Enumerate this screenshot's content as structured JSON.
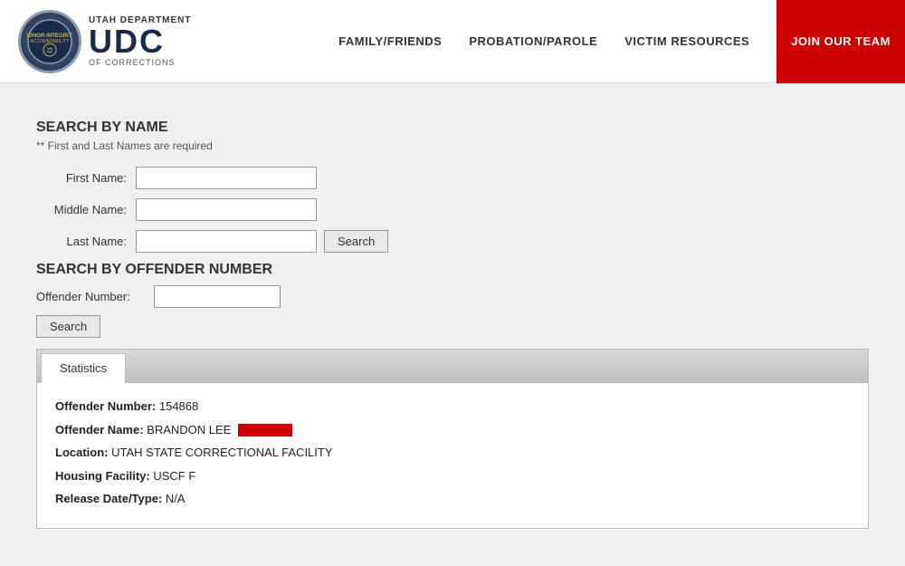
{
  "header": {
    "logo_utah": "UTAH DEPARTMENT",
    "logo_udc": "UDC",
    "logo_sub": "OF CORRECTIONS",
    "nav": {
      "family_friends": "FAMILY/FRIENDS",
      "probation_parole": "PROBATION/PAROLE",
      "victim_resources": "VICTIM RESOURCES",
      "join_team": "JOIN OUR TEAM"
    }
  },
  "search_name": {
    "title": "SEARCH BY NAME",
    "subtitle": "** First and Last Names are required",
    "first_name_label": "First Name:",
    "middle_name_label": "Middle Name:",
    "last_name_label": "Last Name:",
    "search_button": "Search"
  },
  "search_offender": {
    "title": "SEARCH BY OFFENDER NUMBER",
    "offender_label": "Offender Number:",
    "search_button": "Search"
  },
  "statistics_tab": {
    "label": "Statistics",
    "offender_number_label": "Offender Number:",
    "offender_number_value": "154868",
    "offender_name_label": "Offender Name:",
    "offender_name_value": "BRANDON LEE",
    "location_label": "Location:",
    "location_value": "UTAH STATE CORRECTIONAL FACILITY",
    "housing_label": "Housing Facility:",
    "housing_value": "USCF F",
    "release_label": "Release Date/Type:",
    "release_value": "N/A"
  }
}
